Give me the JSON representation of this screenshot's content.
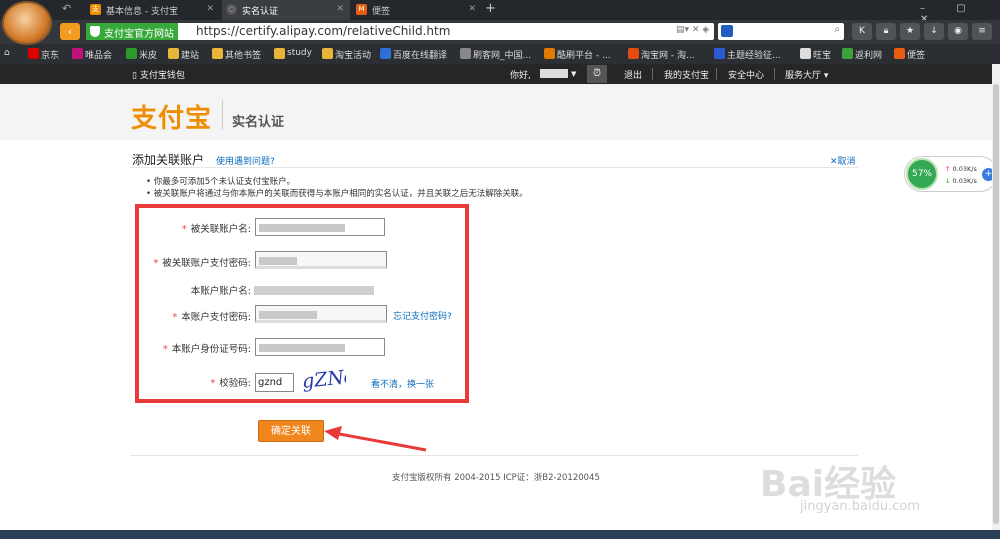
{
  "browser": {
    "tabs": [
      {
        "label": "基本信息 - 支付宝",
        "active": false
      },
      {
        "label": "实名认证",
        "active": true
      },
      {
        "label": "便签",
        "active": false
      }
    ],
    "address": {
      "secure_label": "支付宝官方网站",
      "url": "https://certify.alipay.com/relativeChild.htm"
    },
    "bookmarks": [
      "京东",
      "唯品会",
      "米皮",
      "建站",
      "其他书签",
      "study",
      "淘宝活动",
      "百度在线翻译",
      "刷客网_中国...",
      "酷刷平台 - ...",
      "淘宝网 - 淘...",
      "主题经验征...",
      "旺宝",
      "返利网",
      "便签"
    ],
    "bookmark_icons": {
      "jd": "JD",
      "vip": "特",
      "mipi": "iz"
    }
  },
  "topnav": {
    "wallet": "支付宝钱包",
    "greeting": "你好,",
    "logout": "退出",
    "my_alipay": "我的支付宝",
    "security": "安全中心",
    "service": "服务大厅"
  },
  "brand": {
    "logo_text": "支付宝",
    "subtitle": "实名认证"
  },
  "page": {
    "title": "添加关联账户",
    "help_link": "使用遇到问题?",
    "cancel": "取消",
    "notes": [
      "• 你最多可添加5个未认证支付宝账户。",
      "• 被关联账户将通过与你本账户的关联而获得与本账户相同的实名认证，并且关联之后无法解除关联。"
    ]
  },
  "form": {
    "fields": [
      {
        "label": "被关联账户名:",
        "required": true
      },
      {
        "label": "被关联账户支付密码:",
        "required": true
      },
      {
        "label": "本账户账户名:",
        "required": false
      },
      {
        "label": "本账户支付密码:",
        "required": true
      },
      {
        "label": "本账户身份证号码:",
        "required": true
      },
      {
        "label": "校验码:",
        "required": true
      }
    ],
    "forgot_password": "忘记支付密码?",
    "captcha_value": "gznd",
    "captcha_image_text": "gZNd",
    "refresh_captcha": "看不清，换一张",
    "submit": "确定关联"
  },
  "footer": {
    "text": "支付宝版权所有 2004-2015 ICP证：浙B2-20120045"
  },
  "widget": {
    "percent": "57%",
    "up": "0.03K/s",
    "down": "0.03K/s"
  },
  "watermark": {
    "main": "Bai经验",
    "sub": "jingyan.baidu.com"
  },
  "colors": {
    "accent": "#f08c00",
    "link": "#0b6bbf",
    "highlight": "#e83a3a",
    "secure": "#37a93b"
  }
}
